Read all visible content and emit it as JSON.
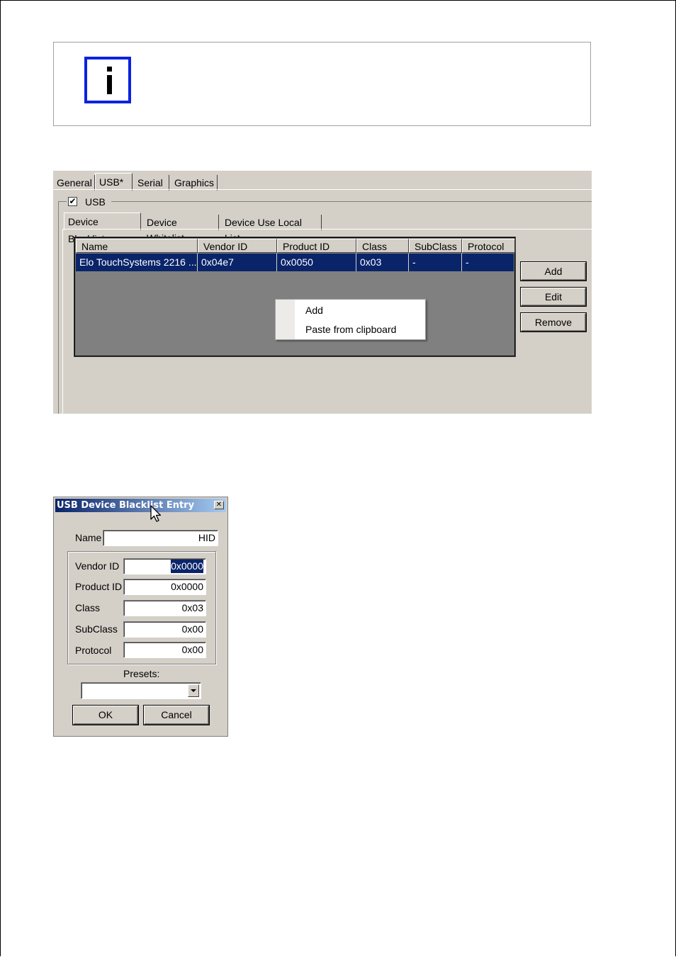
{
  "settings_panel": {
    "tabs": [
      "General",
      "USB*",
      "Serial",
      "Graphics"
    ],
    "usb_checkbox_label": "USB",
    "usb_checked_mark": "✔",
    "subtabs": [
      "Device Blacklist",
      "Device Whitelist",
      "Device Use Local List"
    ],
    "columns": [
      "Name",
      "Vendor ID",
      "Product ID",
      "Class",
      "SubClass",
      "Protocol"
    ],
    "rows": [
      [
        "Elo TouchSystems 2216 ...",
        "0x04e7",
        "0x0050",
        "0x03",
        "-",
        "-"
      ]
    ],
    "buttons": {
      "add": "Add",
      "edit": "Edit",
      "remove": "Remove"
    },
    "context_menu": [
      "Add",
      "Paste from clipboard"
    ]
  },
  "dialog": {
    "title": "USB Device Blacklist Entry",
    "close_glyph": "✕",
    "name_label": "Name",
    "name_value": "HID",
    "fields": [
      {
        "label": "Vendor ID",
        "value": "0x0000"
      },
      {
        "label": "Product ID",
        "value": "0x0000"
      },
      {
        "label": "Class",
        "value": "0x03"
      },
      {
        "label": "SubClass",
        "value": "0x00"
      },
      {
        "label": "Protocol",
        "value": "0x00"
      }
    ],
    "presets_label": "Presets:",
    "presets_value": "",
    "ok_label": "OK",
    "cancel_label": "Cancel"
  },
  "colors": {
    "info_icon_border": "#0b22e0",
    "selection": "#0a246a",
    "window_face": "#d4d0c8"
  }
}
